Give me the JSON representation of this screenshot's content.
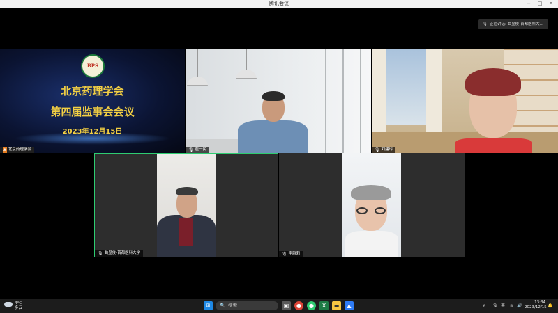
{
  "window": {
    "title": "腾讯会议",
    "minimize": "−",
    "maximize": "□",
    "close": "✕"
  },
  "speaking": {
    "text": "正在讲话: 曲显俊-首都医科大..."
  },
  "tiles": [
    {
      "id": "banner",
      "name": "北京药理学会",
      "badge": "▲",
      "logo_text": "BPS",
      "line1": "北京药理学会",
      "line2": "第四届监事会会议",
      "line3": "2023年12月15日"
    },
    {
      "id": "office",
      "name": "崔一民"
    },
    {
      "id": "room",
      "name": "刘建玲"
    },
    {
      "id": "man",
      "name": "曲显俊-首都医科大学"
    },
    {
      "id": "woman",
      "name": "李腾莉"
    }
  ],
  "taskbar": {
    "weather_temp": "4°C",
    "weather_desc": "多云",
    "search_label": "搜索",
    "lang": "英",
    "time": "13:34",
    "date": "2023/12/15",
    "icons": [
      "start-icon",
      "search-icon",
      "task-view-icon",
      "chrome-icon",
      "wechat-icon",
      "excel-icon",
      "file-explorer-icon",
      "tencent-meeting-icon"
    ]
  },
  "colors": {
    "active_border": "#2ecc71",
    "banner_text": "#f2cf43",
    "taskbar": "#1c1c1c"
  }
}
